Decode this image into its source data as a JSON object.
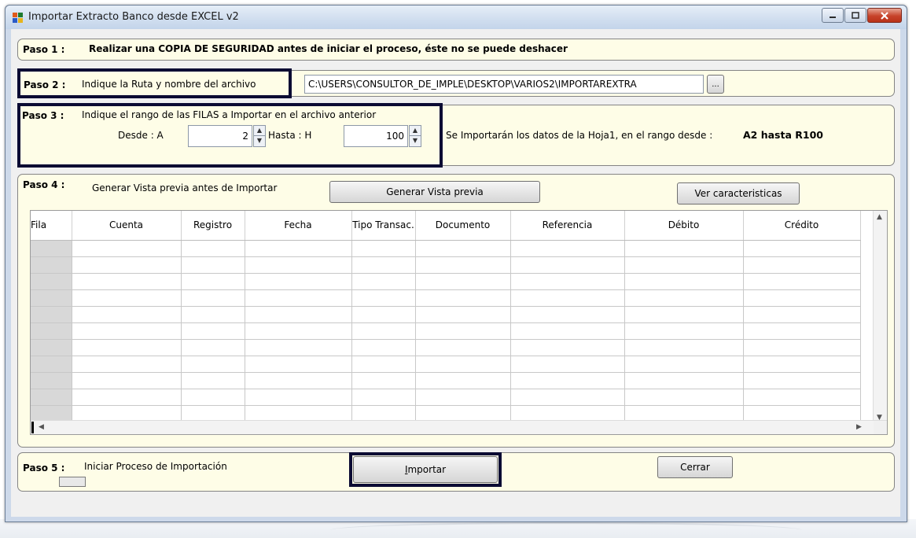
{
  "window": {
    "title": "Importar Extracto Banco desde EXCEL v2"
  },
  "paso1": {
    "label": "Paso 1 :",
    "text": "Realizar una COPIA DE SEGURIDAD antes de iniciar el proceso, éste no se puede deshacer"
  },
  "paso2": {
    "label": "Paso 2 :",
    "text": "Indique la Ruta y nombre del archivo",
    "path_value": "C:\\USERS\\CONSULTOR_DE_IMPLE\\DESKTOP\\VARIOS2\\IMPORTAREXTRA",
    "browse_label": "..."
  },
  "paso3": {
    "label": "Paso 3 :",
    "text": "Indique el rango de las FILAS a Importar en el archivo anterior",
    "desde_label": "Desde  :  A",
    "desde_value": "2",
    "hasta_label": "Hasta  :  H",
    "hasta_value": "100",
    "info": "Se Importarán los datos de la Hoja1,  en el rango desde :",
    "range": "A2 hasta R100"
  },
  "paso4": {
    "label": "Paso 4 :",
    "text": "Generar Vista previa antes de Importar",
    "preview_button": "Generar Vista previa",
    "features_button": "Ver caracteristicas"
  },
  "grid": {
    "columns": [
      "Fila",
      "Cuenta",
      "Registro",
      "Fecha",
      "Tipo Transac.",
      "Documento",
      "Referencia",
      "Débito",
      "Crédito"
    ],
    "row_count": 12
  },
  "paso5": {
    "label": "Paso 5 :",
    "text": "Iniciar Proceso de Importación",
    "import_button": "Importar",
    "close_button": "Cerrar"
  },
  "colors": {
    "panel_bg": "#fefde7",
    "highlight": "#0b0b33",
    "window_frame": "#cdd9ea"
  }
}
